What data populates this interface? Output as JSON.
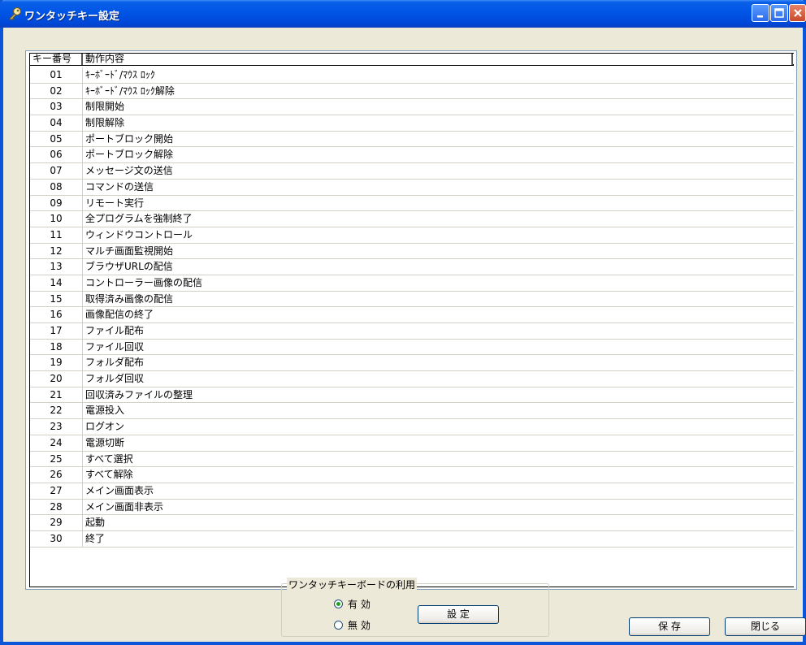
{
  "window": {
    "title": "ワンタッチキー設定",
    "title_icon": "key-icon",
    "controls": [
      "minimize-icon",
      "maximize-icon",
      "close-icon"
    ]
  },
  "listview": {
    "columns": [
      "キー番号",
      "動作内容"
    ],
    "rows": [
      {
        "key": "01",
        "action": "ｷｰﾎﾞｰﾄﾞ/ﾏｳｽ ﾛｯｸ"
      },
      {
        "key": "02",
        "action": "ｷｰﾎﾞｰﾄﾞ/ﾏｳｽ ﾛｯｸ解除"
      },
      {
        "key": "03",
        "action": "制限開始"
      },
      {
        "key": "04",
        "action": "制限解除"
      },
      {
        "key": "05",
        "action": "ポートブロック開始"
      },
      {
        "key": "06",
        "action": "ポートブロック解除"
      },
      {
        "key": "07",
        "action": "メッセージ文の送信"
      },
      {
        "key": "08",
        "action": "コマンドの送信"
      },
      {
        "key": "09",
        "action": "リモート実行"
      },
      {
        "key": "10",
        "action": "全プログラムを強制終了"
      },
      {
        "key": "11",
        "action": "ウィンドウコントロール"
      },
      {
        "key": "12",
        "action": "マルチ画面監視開始"
      },
      {
        "key": "13",
        "action": "ブラウザURLの配信"
      },
      {
        "key": "14",
        "action": "コントローラー画像の配信"
      },
      {
        "key": "15",
        "action": "取得済み画像の配信"
      },
      {
        "key": "16",
        "action": "画像配信の終了"
      },
      {
        "key": "17",
        "action": "ファイル配布"
      },
      {
        "key": "18",
        "action": "ファイル回収"
      },
      {
        "key": "19",
        "action": "フォルダ配布"
      },
      {
        "key": "20",
        "action": "フォルダ回収"
      },
      {
        "key": "21",
        "action": "回収済みファイルの整理"
      },
      {
        "key": "22",
        "action": "電源投入"
      },
      {
        "key": "23",
        "action": "ログオン"
      },
      {
        "key": "24",
        "action": "電源切断"
      },
      {
        "key": "25",
        "action": "すべて選択"
      },
      {
        "key": "26",
        "action": "すべて解除"
      },
      {
        "key": "27",
        "action": "メイン画面表示"
      },
      {
        "key": "28",
        "action": "メイン画面非表示"
      },
      {
        "key": "29",
        "action": "起動"
      },
      {
        "key": "30",
        "action": "終了"
      }
    ]
  },
  "keyboard_group": {
    "label": "ワンタッチキーボードの利用",
    "option_on": "有 効",
    "option_off": "無 効",
    "selected": "有 効"
  },
  "buttons": {
    "setting": "設 定",
    "save": "保 存",
    "close": "閉じる"
  },
  "colors": {
    "titlebar": "#0055E5",
    "window_bg": "#ECE9D8",
    "radio_selected": "#21A121"
  }
}
